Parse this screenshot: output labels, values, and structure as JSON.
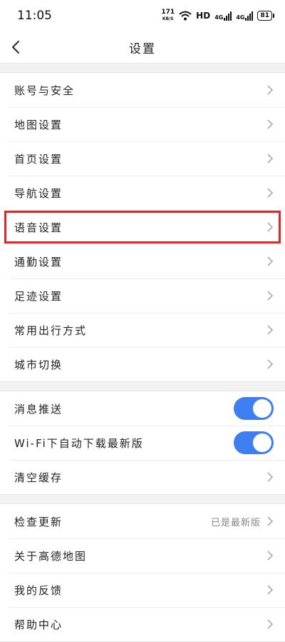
{
  "status_bar": {
    "time": "11:05",
    "net_speed_value": "171",
    "net_speed_unit": "KB/S",
    "hd": "HD",
    "signal1": "4G",
    "signal2": "4G",
    "battery": "81"
  },
  "header": {
    "title": "设置"
  },
  "groups": [
    {
      "items": [
        {
          "label": "账号与安全"
        },
        {
          "label": "地图设置"
        },
        {
          "label": "首页设置"
        },
        {
          "label": "导航设置"
        },
        {
          "label": "语音设置",
          "highlighted": true
        },
        {
          "label": "通勤设置"
        },
        {
          "label": "足迹设置"
        },
        {
          "label": "常用出行方式"
        },
        {
          "label": "城市切换"
        }
      ]
    },
    {
      "items": [
        {
          "label": "消息推送",
          "toggle": true,
          "on": true
        },
        {
          "label": "Wi-Fi下自动下载最新版",
          "toggle": true,
          "on": true
        },
        {
          "label": "清空缓存"
        }
      ]
    },
    {
      "items": [
        {
          "label": "检查更新",
          "value": "已是最新版"
        },
        {
          "label": "关于高德地图"
        },
        {
          "label": "我的反馈"
        },
        {
          "label": "帮助中心"
        }
      ]
    }
  ],
  "colors": {
    "toggle_on": "#3f7ef0",
    "highlight_border": "#e0262b"
  }
}
